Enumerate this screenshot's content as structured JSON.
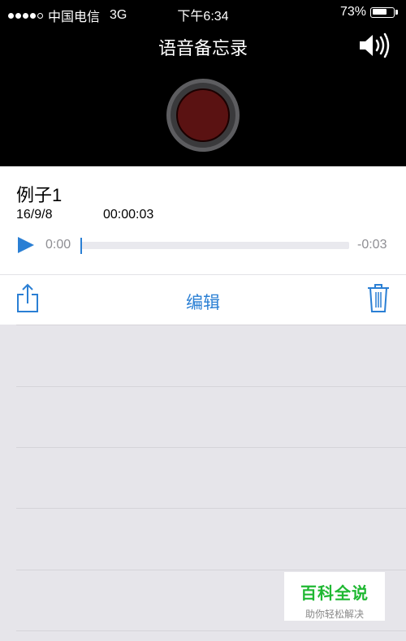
{
  "status_bar": {
    "carrier": "中国电信",
    "network": "3G",
    "time": "下午6:34",
    "battery_percent": "73%",
    "battery_level": 0.73,
    "signal_bars_filled": 4,
    "signal_bars_total": 5
  },
  "header": {
    "title": "语音备忘录",
    "speaker_icon": "speaker-volume-icon",
    "record_icon": "record-button-icon",
    "record_color": "#5a1212"
  },
  "recording": {
    "title": "例子1",
    "date": "16/9/8",
    "duration": "00:00:03",
    "elapsed": "0:00",
    "remaining": "-0:03",
    "progress": 0.0
  },
  "actions": {
    "share_icon": "share-icon",
    "edit_label": "编辑",
    "trash_icon": "trash-icon",
    "accent_color": "#2a7fd4"
  },
  "watermark": {
    "brand": "百科全说",
    "slogan": "助你轻松解决"
  }
}
